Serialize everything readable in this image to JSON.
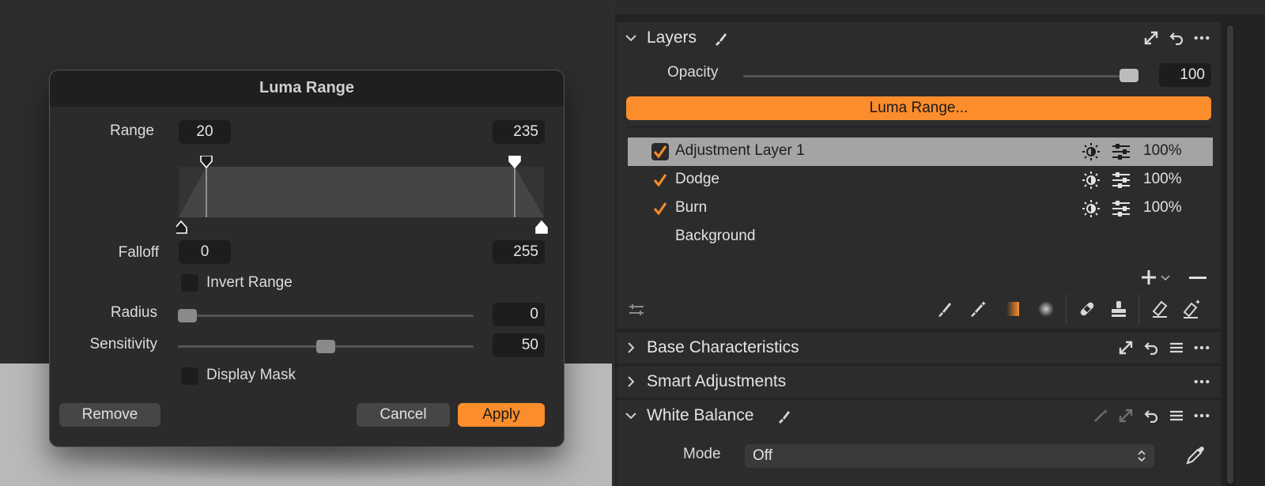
{
  "dialog": {
    "title": "Luma Range",
    "range_label": "Range",
    "range_low": "20",
    "range_high": "235",
    "falloff_label": "Falloff",
    "falloff_low": "0",
    "falloff_high": "255",
    "invert_label": "Invert Range",
    "invert_checked": false,
    "radius_label": "Radius",
    "radius_value": "0",
    "radius_fraction": 0.0,
    "sensitivity_label": "Sensitivity",
    "sensitivity_value": "50",
    "sensitivity_fraction": 0.5,
    "display_mask_label": "Display Mask",
    "display_mask_checked": false,
    "remove_label": "Remove",
    "cancel_label": "Cancel",
    "apply_label": "Apply"
  },
  "layers_panel": {
    "title": "Layers",
    "opacity_label": "Opacity",
    "opacity_value": "100",
    "opacity_fraction": 1.0,
    "luma_button_label": "Luma Range...",
    "layers": [
      {
        "name": "Adjustment Layer 1",
        "checked": true,
        "selected": true,
        "percent": "100%"
      },
      {
        "name": "Dodge",
        "checked": true,
        "selected": false,
        "percent": "100%"
      },
      {
        "name": "Burn",
        "checked": true,
        "selected": false,
        "percent": "100%"
      },
      {
        "name": "Background",
        "checked": false,
        "selected": false,
        "percent": ""
      }
    ]
  },
  "sections": {
    "base_characteristics": "Base Characteristics",
    "smart_adjustments": "Smart Adjustments",
    "white_balance": "White Balance"
  },
  "white_balance": {
    "mode_label": "Mode",
    "mode_value": "Off"
  },
  "colors": {
    "accent": "#fb8d2c",
    "selected_row": "#a4a4a4"
  }
}
